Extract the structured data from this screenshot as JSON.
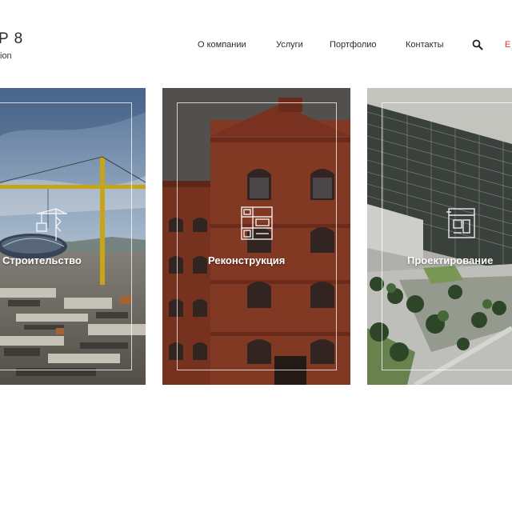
{
  "header": {
    "logo_title": "P 8",
    "logo_sub": "ion",
    "nav": [
      {
        "label": "О компании"
      },
      {
        "label": "Услуги"
      },
      {
        "label": "Портфолио"
      },
      {
        "label": "Контакты"
      }
    ],
    "search_icon": "search-icon",
    "lang_label": "E"
  },
  "cards": [
    {
      "label": "Строительство",
      "icon": "crane-icon"
    },
    {
      "label": "Реконструкция",
      "icon": "building-plan-icon"
    },
    {
      "label": "Проектирование",
      "icon": "blueprint-icon"
    }
  ],
  "colors": {
    "accent": "#e03a2e",
    "text": "#2b2b2b",
    "brick": "#8f3a22"
  }
}
